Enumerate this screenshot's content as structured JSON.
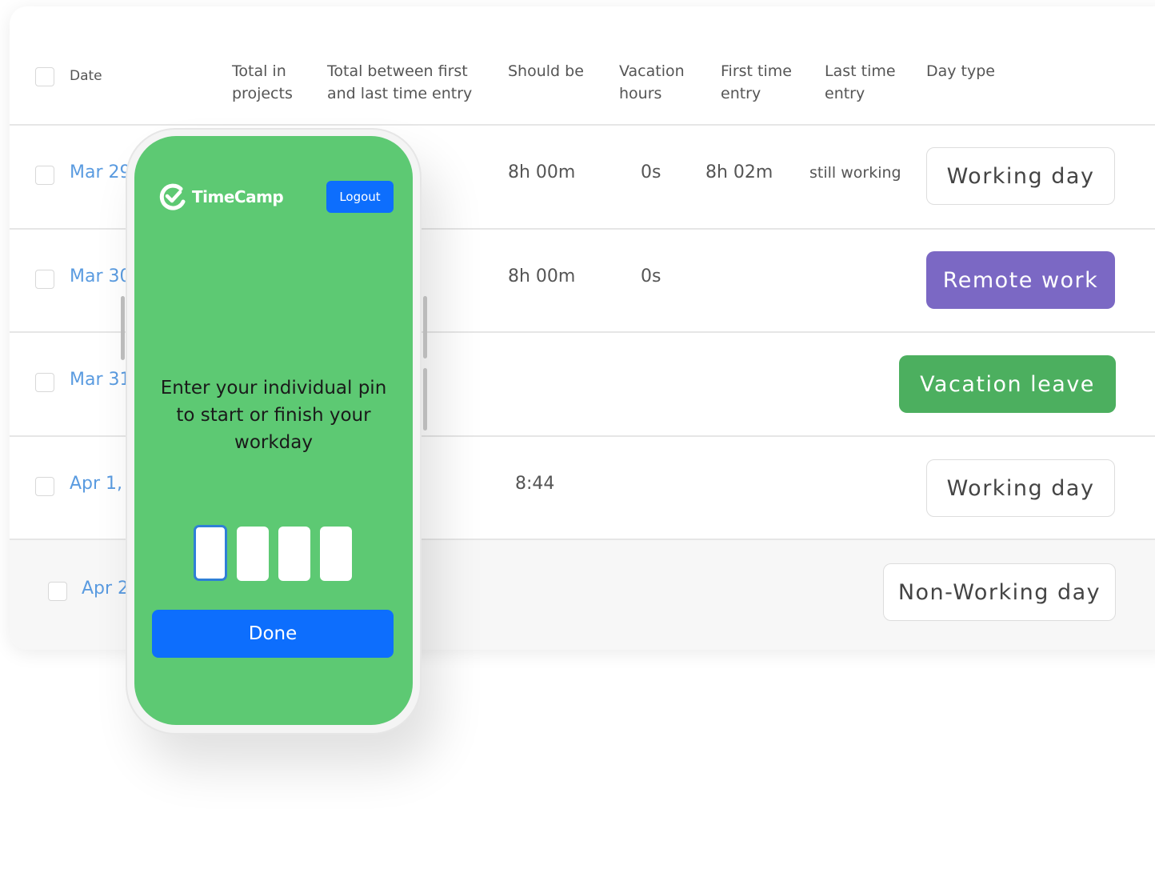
{
  "table": {
    "headers": [
      "Date",
      "Total in projects",
      "Total between first and last time entry",
      "Should be",
      "Vacation hours",
      "First time entry",
      "Last time entry",
      "Day type"
    ],
    "rows": [
      {
        "date": "Mar 29",
        "should_be": "8h 00m",
        "vacation": "0s",
        "first": "8h 02m",
        "last": "still working",
        "day_type": "Working day"
      },
      {
        "date": "Mar 30",
        "should_be": "8h 00m",
        "vacation": "0s",
        "first": "",
        "last": "",
        "day_type": "Remote work"
      },
      {
        "date": "Mar 31",
        "should_be": "",
        "vacation": "",
        "first": "",
        "last": "",
        "day_type": "Vacation leave"
      },
      {
        "date": "Apr 1,",
        "should_be": "8:44",
        "vacation": "",
        "first": "",
        "last": "",
        "day_type": "Working day"
      },
      {
        "date": "Apr 2",
        "should_be": "",
        "vacation": "",
        "first": "",
        "last": "",
        "day_type": "Non-Working day"
      }
    ]
  },
  "colors": {
    "remote": "#7b68c4",
    "vacation": "#4caf5f",
    "phone_bg": "#5dc973",
    "primary": "#0d6efd",
    "date_link": "#5a9be0"
  },
  "phone": {
    "brand": "TimeCamp",
    "logout": "Logout",
    "prompt": "Enter your individual pin to start or finish your workday",
    "done": "Done",
    "pin_digits": 4
  }
}
